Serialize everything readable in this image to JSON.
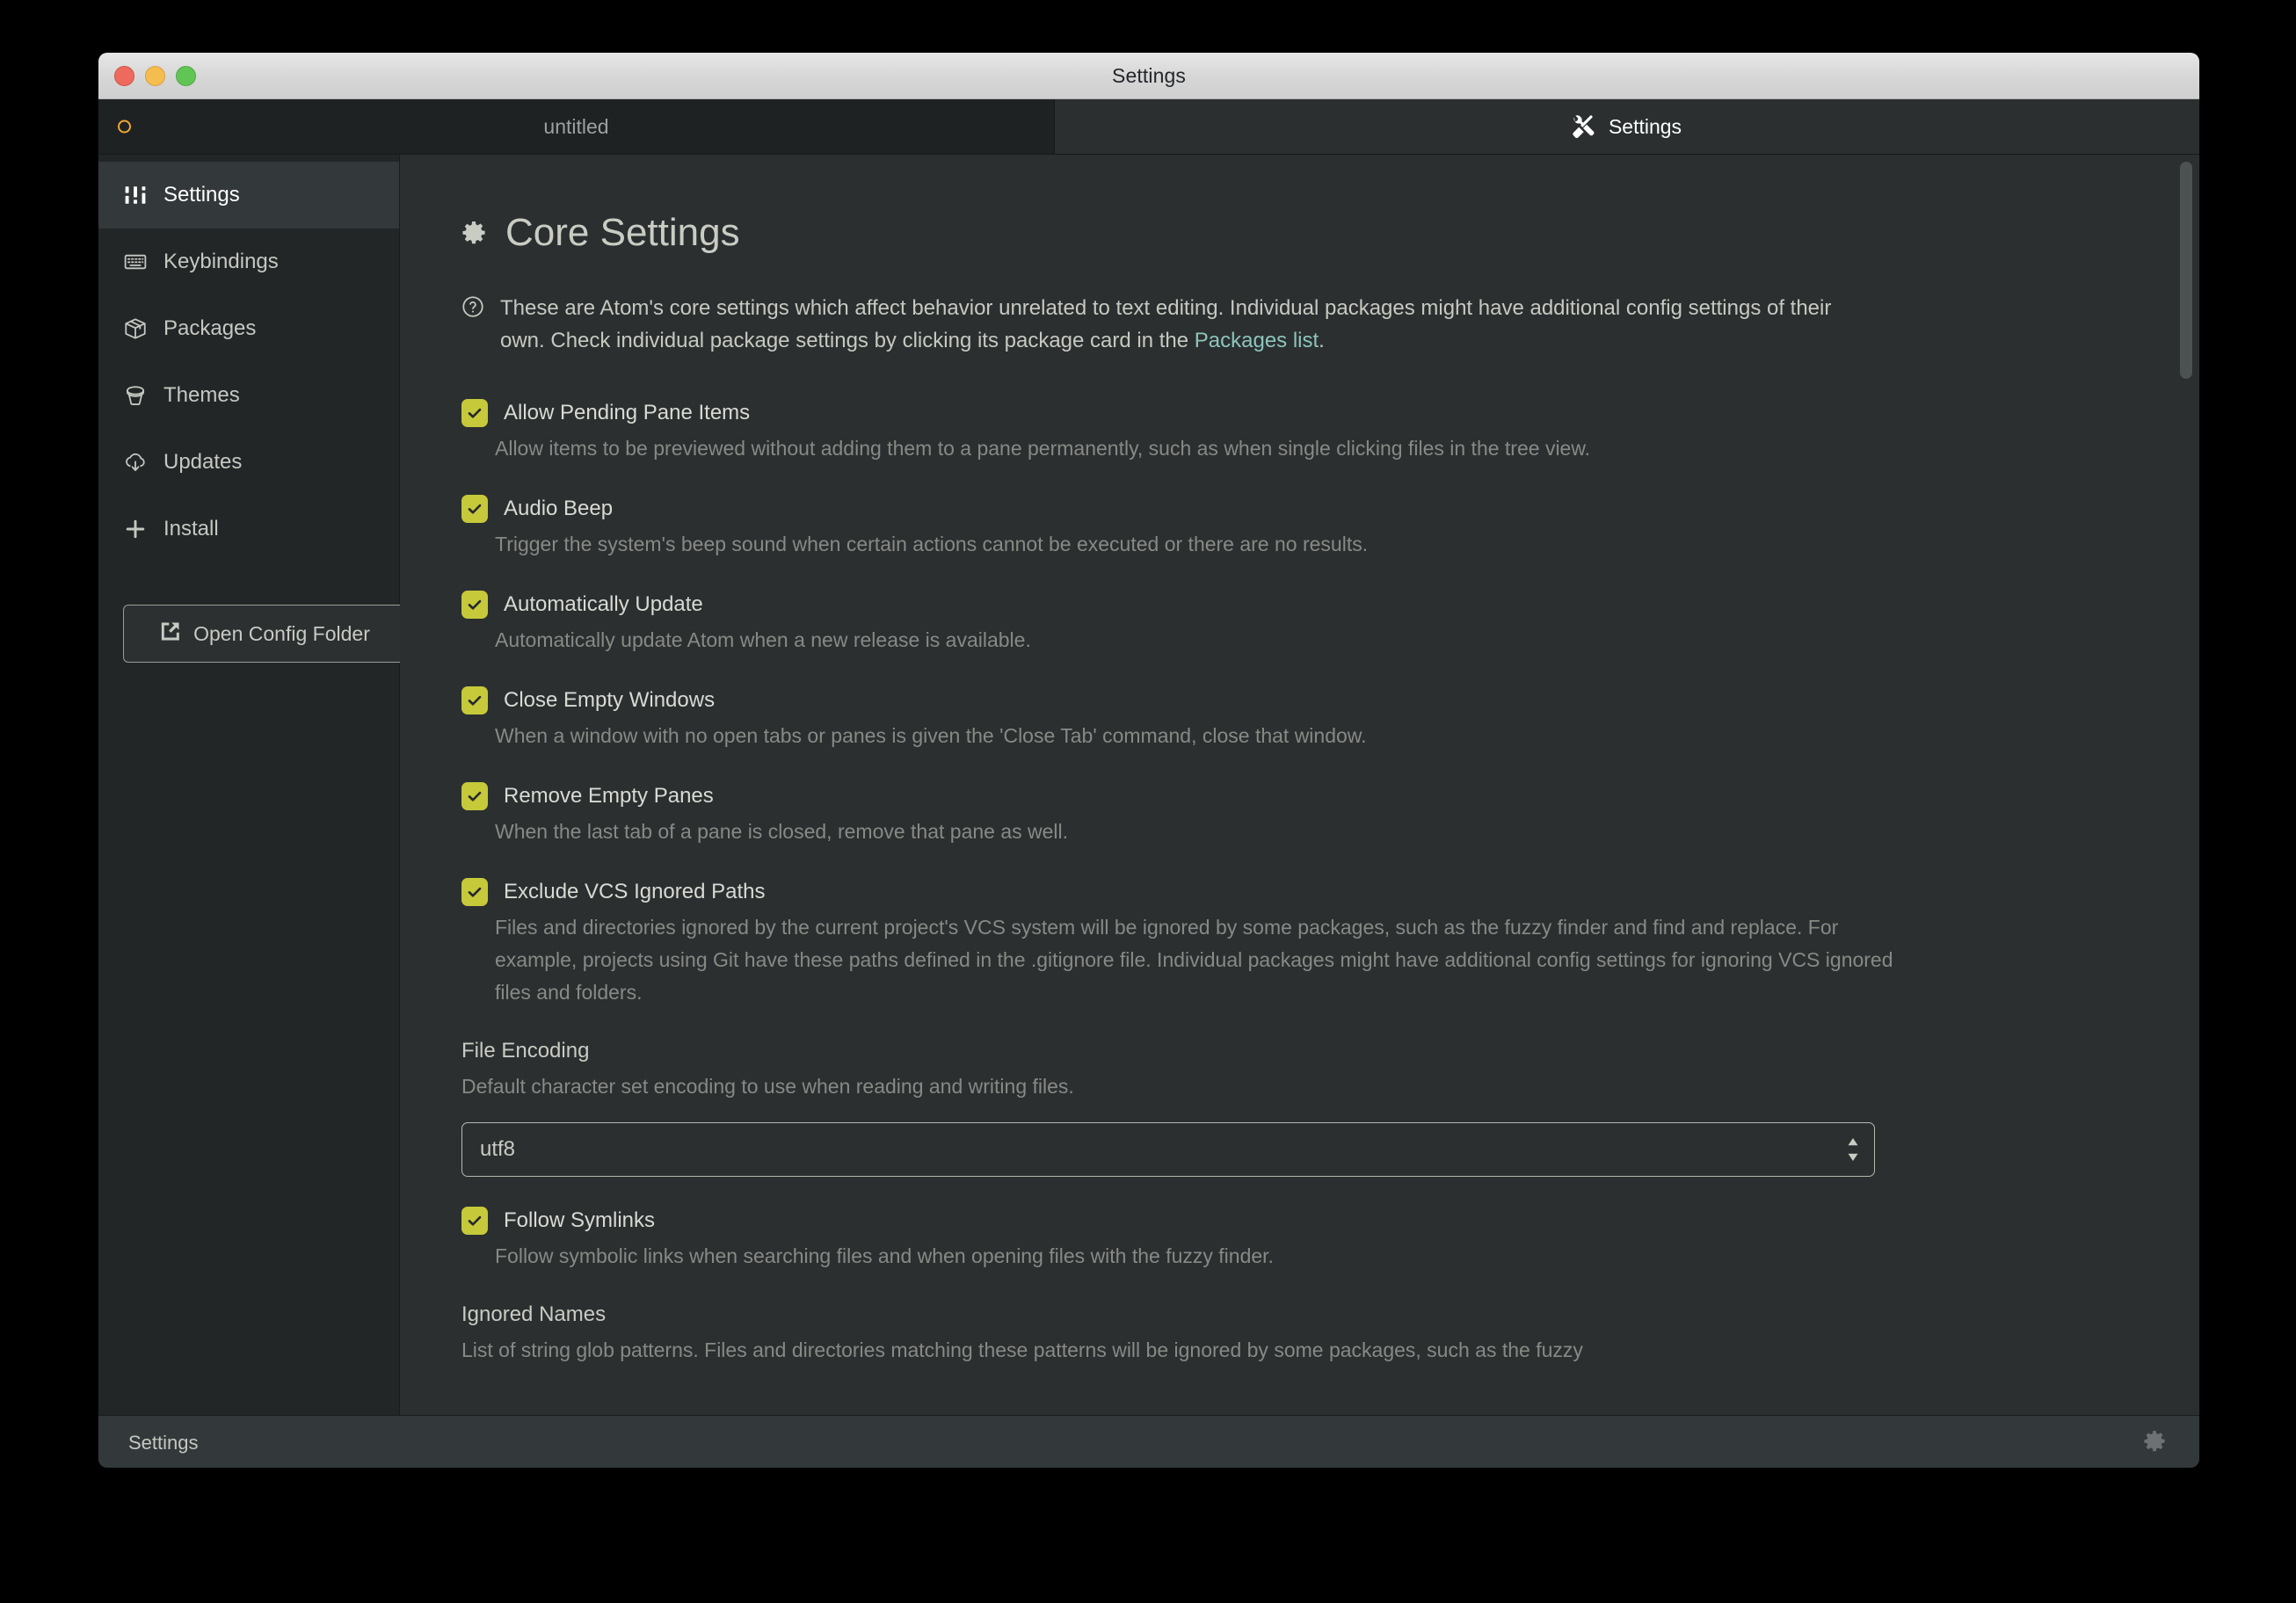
{
  "window": {
    "title": "Settings",
    "traffic_lights": [
      "close",
      "minimize",
      "maximize"
    ]
  },
  "tabs": [
    {
      "label": "untitled",
      "icon": "modified-circle-icon",
      "active": false
    },
    {
      "label": "Settings",
      "icon": "tools-icon",
      "active": true
    }
  ],
  "sidebar": {
    "items": [
      {
        "label": "Settings",
        "icon": "sliders-icon",
        "active": true
      },
      {
        "label": "Keybindings",
        "icon": "keyboard-icon",
        "active": false
      },
      {
        "label": "Packages",
        "icon": "package-icon",
        "active": false
      },
      {
        "label": "Themes",
        "icon": "paintbucket-icon",
        "active": false
      },
      {
        "label": "Updates",
        "icon": "cloud-download-icon",
        "active": false
      },
      {
        "label": "Install",
        "icon": "plus-icon",
        "active": false
      }
    ],
    "config_button": {
      "label": "Open Config Folder",
      "icon": "external-link-icon"
    }
  },
  "main": {
    "title": "Core Settings",
    "title_icon": "gear-icon",
    "description_icon": "question-circle-icon",
    "description_part1": "These are Atom's core settings which affect behavior unrelated to text editing. Individual packages might have additional config settings of their own. Check individual package settings by clicking its package card in the ",
    "description_link": "Packages list",
    "description_part2": ".",
    "settings": [
      {
        "label": "Allow Pending Pane Items",
        "checked": true,
        "description": "Allow items to be previewed without adding them to a pane permanently, such as when single clicking files in the tree view."
      },
      {
        "label": "Audio Beep",
        "checked": true,
        "description": "Trigger the system's beep sound when certain actions cannot be executed or there are no results."
      },
      {
        "label": "Automatically Update",
        "checked": true,
        "description": "Automatically update Atom when a new release is available."
      },
      {
        "label": "Close Empty Windows",
        "checked": true,
        "description": "When a window with no open tabs or panes is given the 'Close Tab' command, close that window."
      },
      {
        "label": "Remove Empty Panes",
        "checked": true,
        "description": "When the last tab of a pane is closed, remove that pane as well."
      },
      {
        "label": "Exclude VCS Ignored Paths",
        "checked": true,
        "description": "Files and directories ignored by the current project's VCS system will be ignored by some packages, such as the fuzzy finder and find and replace. For example, projects using Git have these paths defined in the .gitignore file. Individual packages might have additional config settings for ignoring VCS ignored files and folders."
      }
    ],
    "file_encoding": {
      "title": "File Encoding",
      "description": "Default character set encoding to use when reading and writing files.",
      "value": "utf8"
    },
    "follow_symlinks": {
      "label": "Follow Symlinks",
      "checked": true,
      "description": "Follow symbolic links when searching files and when opening files with the fuzzy finder."
    },
    "ignored_names": {
      "title": "Ignored Names",
      "description": "List of string glob patterns. Files and directories matching these patterns will be ignored by some packages, such as the fuzzy"
    }
  },
  "statusbar": {
    "left_label": "Settings",
    "right_icon": "gear-icon"
  },
  "colors": {
    "checkbox_accent": "#c5c93a",
    "link": "#8ec4bd",
    "tab_modified": "#f0a732",
    "panel_bg": "#2b2f30",
    "sidebar_bg": "#222627"
  }
}
